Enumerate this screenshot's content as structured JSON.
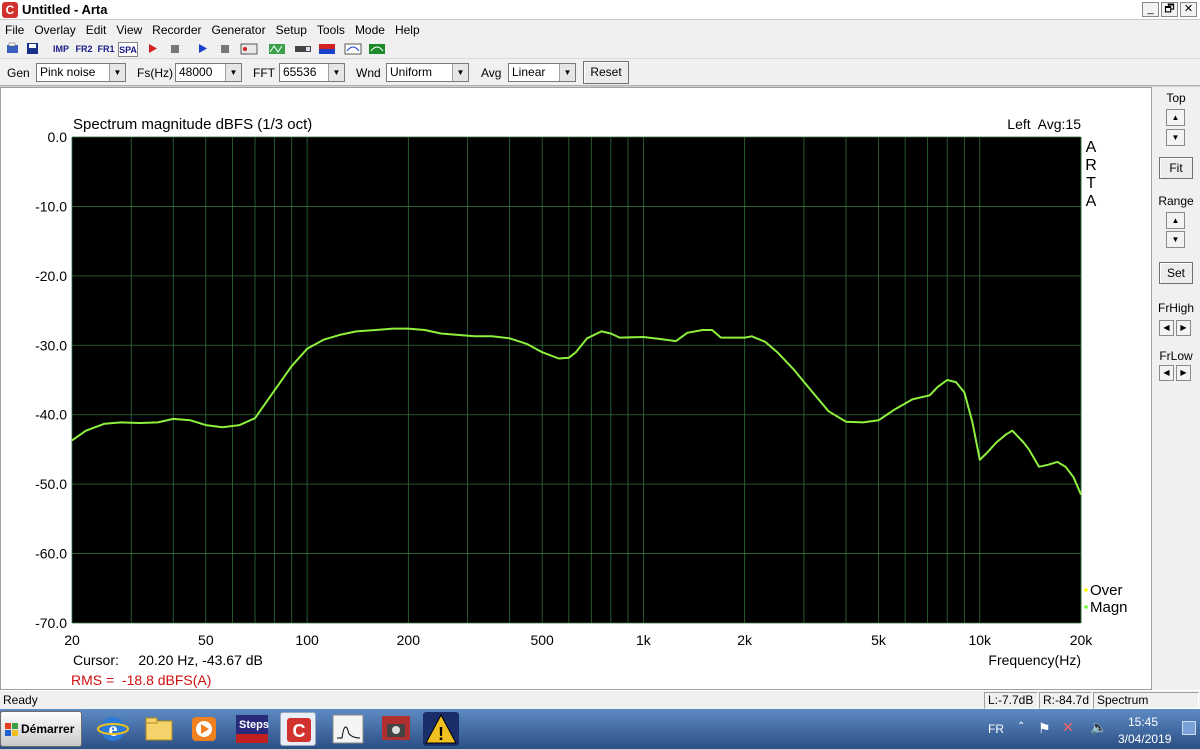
{
  "window": {
    "title": "Untitled - Arta",
    "controls": [
      "_",
      "🗗",
      "✕"
    ]
  },
  "menu": [
    "File",
    "Overlay",
    "Edit",
    "View",
    "Recorder",
    "Generator",
    "Setup",
    "Tools",
    "Mode",
    "Help"
  ],
  "toolbar_icons": {
    "imp": "IMP",
    "fr2": "FR2",
    "fr1": "FR1",
    "spa": "SPA"
  },
  "settings": {
    "gen_label": "Gen",
    "gen_value": "Pink noise",
    "fs_label": "Fs(Hz)",
    "fs_value": "48000",
    "fft_label": "FFT",
    "fft_value": "65536",
    "wnd_label": "Wnd",
    "wnd_value": "Uniform",
    "avg_label": "Avg",
    "avg_value": "Linear",
    "reset_label": "Reset"
  },
  "chart_data": {
    "type": "line",
    "title": "Spectrum magnitude dBFS (1/3 oct)",
    "channel_info": "Left  Avg:15",
    "watermark": [
      "A",
      "R",
      "T",
      "A"
    ],
    "xlabel": "Frequency(Hz)",
    "ylabel": "",
    "x_scale": "log",
    "xlim": [
      20,
      20000
    ],
    "ylim": [
      -70,
      0
    ],
    "x_ticks": [
      {
        "value": 20,
        "label": "20"
      },
      {
        "value": 50,
        "label": "50"
      },
      {
        "value": 100,
        "label": "100"
      },
      {
        "value": 200,
        "label": "200"
      },
      {
        "value": 500,
        "label": "500"
      },
      {
        "value": 1000,
        "label": "1k"
      },
      {
        "value": 2000,
        "label": "2k"
      },
      {
        "value": 5000,
        "label": "5k"
      },
      {
        "value": 10000,
        "label": "10k"
      },
      {
        "value": 20000,
        "label": "20k"
      }
    ],
    "y_ticks": [
      {
        "value": 0,
        "label": "0.0"
      },
      {
        "value": -10,
        "label": "-10.0"
      },
      {
        "value": -20,
        "label": "-20.0"
      },
      {
        "value": -30,
        "label": "-30.0"
      },
      {
        "value": -40,
        "label": "-40.0"
      },
      {
        "value": -50,
        "label": "-50.0"
      },
      {
        "value": -60,
        "label": "-60.0"
      },
      {
        "value": -70,
        "label": "-70.0"
      }
    ],
    "grid": true,
    "background": "#000000",
    "grid_color": "#2f6f3a",
    "legend": [
      {
        "name": "Over",
        "color": "#ffff00"
      },
      {
        "name": "Magn",
        "color": "#66ff33"
      }
    ],
    "series": [
      {
        "name": "Magn",
        "color": "#8cf03c",
        "points": [
          [
            20,
            -43.7
          ],
          [
            22,
            -42.3
          ],
          [
            25,
            -41.3
          ],
          [
            28,
            -41.1
          ],
          [
            32,
            -41.2
          ],
          [
            36,
            -41.1
          ],
          [
            40,
            -40.6
          ],
          [
            45,
            -40.8
          ],
          [
            50,
            -41.5
          ],
          [
            56,
            -41.8
          ],
          [
            63,
            -41.5
          ],
          [
            70,
            -40.5
          ],
          [
            80,
            -36.5
          ],
          [
            90,
            -33.0
          ],
          [
            100,
            -30.5
          ],
          [
            112,
            -29.2
          ],
          [
            125,
            -28.5
          ],
          [
            140,
            -28.0
          ],
          [
            160,
            -27.8
          ],
          [
            180,
            -27.6
          ],
          [
            200,
            -27.6
          ],
          [
            224,
            -27.8
          ],
          [
            250,
            -28.3
          ],
          [
            280,
            -28.5
          ],
          [
            315,
            -28.7
          ],
          [
            355,
            -28.7
          ],
          [
            400,
            -29.0
          ],
          [
            450,
            -29.8
          ],
          [
            500,
            -31.0
          ],
          [
            560,
            -31.9
          ],
          [
            600,
            -31.8
          ],
          [
            630,
            -31.0
          ],
          [
            680,
            -29.0
          ],
          [
            750,
            -28.0
          ],
          [
            800,
            -28.3
          ],
          [
            850,
            -28.9
          ],
          [
            1000,
            -28.8
          ],
          [
            1120,
            -29.1
          ],
          [
            1250,
            -29.4
          ],
          [
            1350,
            -28.2
          ],
          [
            1500,
            -27.8
          ],
          [
            1600,
            -27.8
          ],
          [
            1700,
            -28.9
          ],
          [
            2000,
            -28.9
          ],
          [
            2100,
            -28.7
          ],
          [
            2300,
            -29.5
          ],
          [
            2500,
            -31.0
          ],
          [
            2800,
            -33.5
          ],
          [
            3150,
            -36.5
          ],
          [
            3550,
            -39.5
          ],
          [
            4000,
            -41.0
          ],
          [
            4500,
            -41.1
          ],
          [
            5000,
            -40.8
          ],
          [
            5600,
            -39.2
          ],
          [
            6300,
            -37.8
          ],
          [
            7100,
            -37.2
          ],
          [
            7500,
            -36.0
          ],
          [
            8000,
            -35.0
          ],
          [
            8500,
            -35.3
          ],
          [
            9000,
            -36.8
          ],
          [
            9500,
            -41.0
          ],
          [
            10000,
            -46.5
          ],
          [
            10500,
            -45.5
          ],
          [
            11200,
            -44.0
          ],
          [
            12000,
            -42.8
          ],
          [
            12500,
            -42.3
          ],
          [
            13500,
            -44.0
          ],
          [
            14000,
            -45.0
          ],
          [
            15000,
            -47.5
          ],
          [
            16000,
            -47.2
          ],
          [
            17000,
            -46.8
          ],
          [
            18000,
            -47.5
          ],
          [
            19000,
            -49.0
          ],
          [
            20000,
            -51.5
          ]
        ]
      }
    ]
  },
  "cursor_readout": "Cursor:     20.20 Hz, -43.67 dB",
  "rms_readout": "RMS =  -18.8 dBFS(A)",
  "right_panel": {
    "top_label": "Top",
    "fit_label": "Fit",
    "range_label": "Range",
    "set_label": "Set",
    "frhigh_label": "FrHigh",
    "frlow_label": "FrLow"
  },
  "status": {
    "ready": "Ready",
    "left_level": "L:-7.7dB",
    "right_level": "R:-84.7d",
    "mode": "Spectrum Analyzer"
  },
  "taskbar": {
    "start_label": "Démarrer",
    "steps_label": "Steps",
    "language": "FR",
    "time": "15:45",
    "date": "3/04/2019"
  }
}
